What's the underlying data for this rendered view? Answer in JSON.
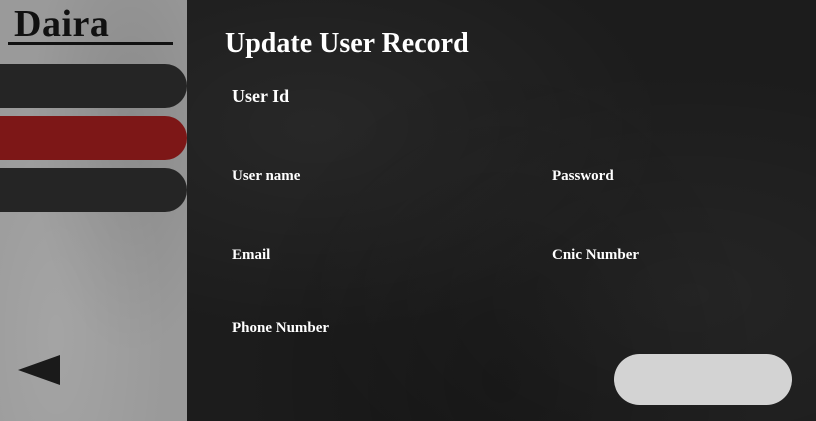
{
  "sidebar": {
    "brand": "Daira",
    "nav_items": [
      {
        "label": "",
        "state": "normal"
      },
      {
        "label": "",
        "state": "active"
      },
      {
        "label": "",
        "state": "normal"
      }
    ],
    "back_icon": "back-triangle-icon"
  },
  "main": {
    "title": "Update User Record",
    "fields": {
      "user_id": "User Id",
      "user_name": "User name",
      "password": "Password",
      "email": "Email",
      "cnic_number": "Cnic Number",
      "phone_number": "Phone Number"
    },
    "action_button_label": ""
  },
  "colors": {
    "active_nav": "#7d1717",
    "nav": "#252525",
    "sidebar_bg": "#9a9a9a",
    "main_bg": "#1c1c1c",
    "button_bg": "#d3d3d3"
  }
}
